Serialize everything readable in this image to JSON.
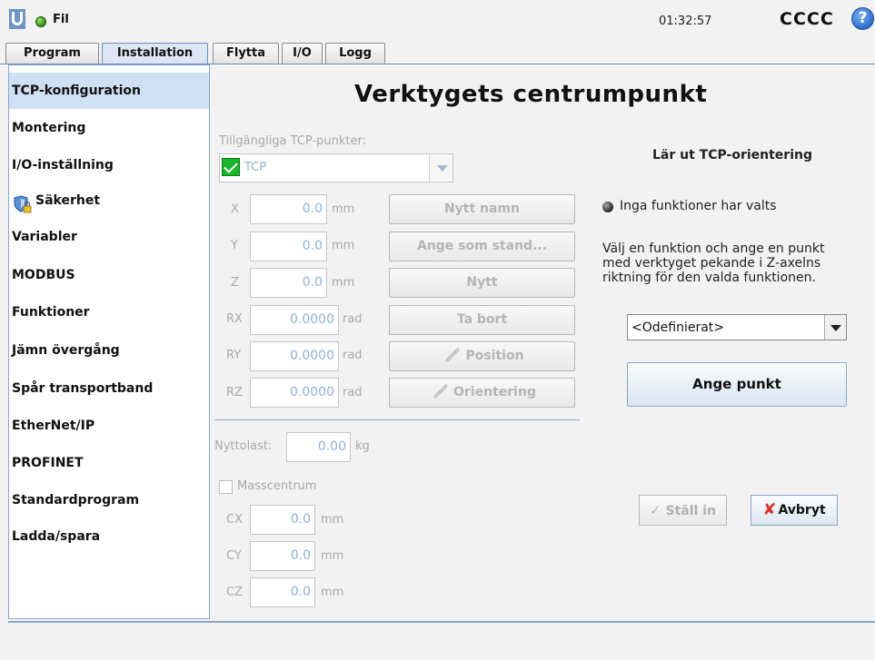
{
  "header": {
    "file_label": "Fil",
    "clock": "01:32:57",
    "robot_name": "CCCC",
    "help_glyph": "?"
  },
  "tabs": [
    {
      "label": "Program"
    },
    {
      "label": "Installation"
    },
    {
      "label": "Flytta"
    },
    {
      "label": "I/O"
    },
    {
      "label": "Logg"
    }
  ],
  "sidebar": {
    "items": [
      {
        "label": "TCP-konfiguration"
      },
      {
        "label": "Montering"
      },
      {
        "label": "I/O-inställning"
      },
      {
        "label": "Säkerhet"
      },
      {
        "label": "Variabler"
      },
      {
        "label": "MODBUS"
      },
      {
        "label": "Funktioner"
      },
      {
        "label": "Jämn övergång"
      },
      {
        "label": "Spår transportband"
      },
      {
        "label": "EtherNet/IP"
      },
      {
        "label": "PROFINET"
      },
      {
        "label": "Standardprogram"
      },
      {
        "label": "Ladda/spara"
      }
    ]
  },
  "main": {
    "title": "Verktygets centrumpunkt",
    "available_tcp_label": "Tillgängliga TCP-punkter:",
    "tcp_selected": "TCP",
    "coords": [
      {
        "label": "X",
        "value": "0.0",
        "unit": "mm"
      },
      {
        "label": "Y",
        "value": "0.0",
        "unit": "mm"
      },
      {
        "label": "Z",
        "value": "0.0",
        "unit": "mm"
      },
      {
        "label": "RX",
        "value": "0.0000",
        "unit": "rad"
      },
      {
        "label": "RY",
        "value": "0.0000",
        "unit": "rad"
      },
      {
        "label": "RZ",
        "value": "0.0000",
        "unit": "rad"
      }
    ],
    "buttons": {
      "new_name": "Nytt namn",
      "set_default": "Ange som stand...",
      "new": "Nytt",
      "remove": "Ta bort",
      "position": "Position",
      "orientation": "Orientering"
    },
    "payload_label": "Nyttolast:",
    "payload_value": "0.00",
    "payload_unit": "kg",
    "cog_label": "Masscentrum",
    "cog": [
      {
        "label": "CX",
        "value": "0.0",
        "unit": "mm"
      },
      {
        "label": "CY",
        "value": "0.0",
        "unit": "mm"
      },
      {
        "label": "CZ",
        "value": "0.0",
        "unit": "mm"
      }
    ]
  },
  "teach": {
    "heading": "Lär ut TCP-orientering",
    "status": "Inga funktioner har valts",
    "instructions": "Välj en funktion och ange en punkt med verktyget pekande i Z-axelns riktning för den valda funktionen.",
    "feature_select": "<Odefinierat>",
    "set_point": "Ange punkt",
    "ok": "Ställ in",
    "cancel": "Avbryt"
  },
  "colors": {
    "accent": "#8aa7cc",
    "selected": "#cfe0f4",
    "status_ok": "#2e8b1e"
  }
}
